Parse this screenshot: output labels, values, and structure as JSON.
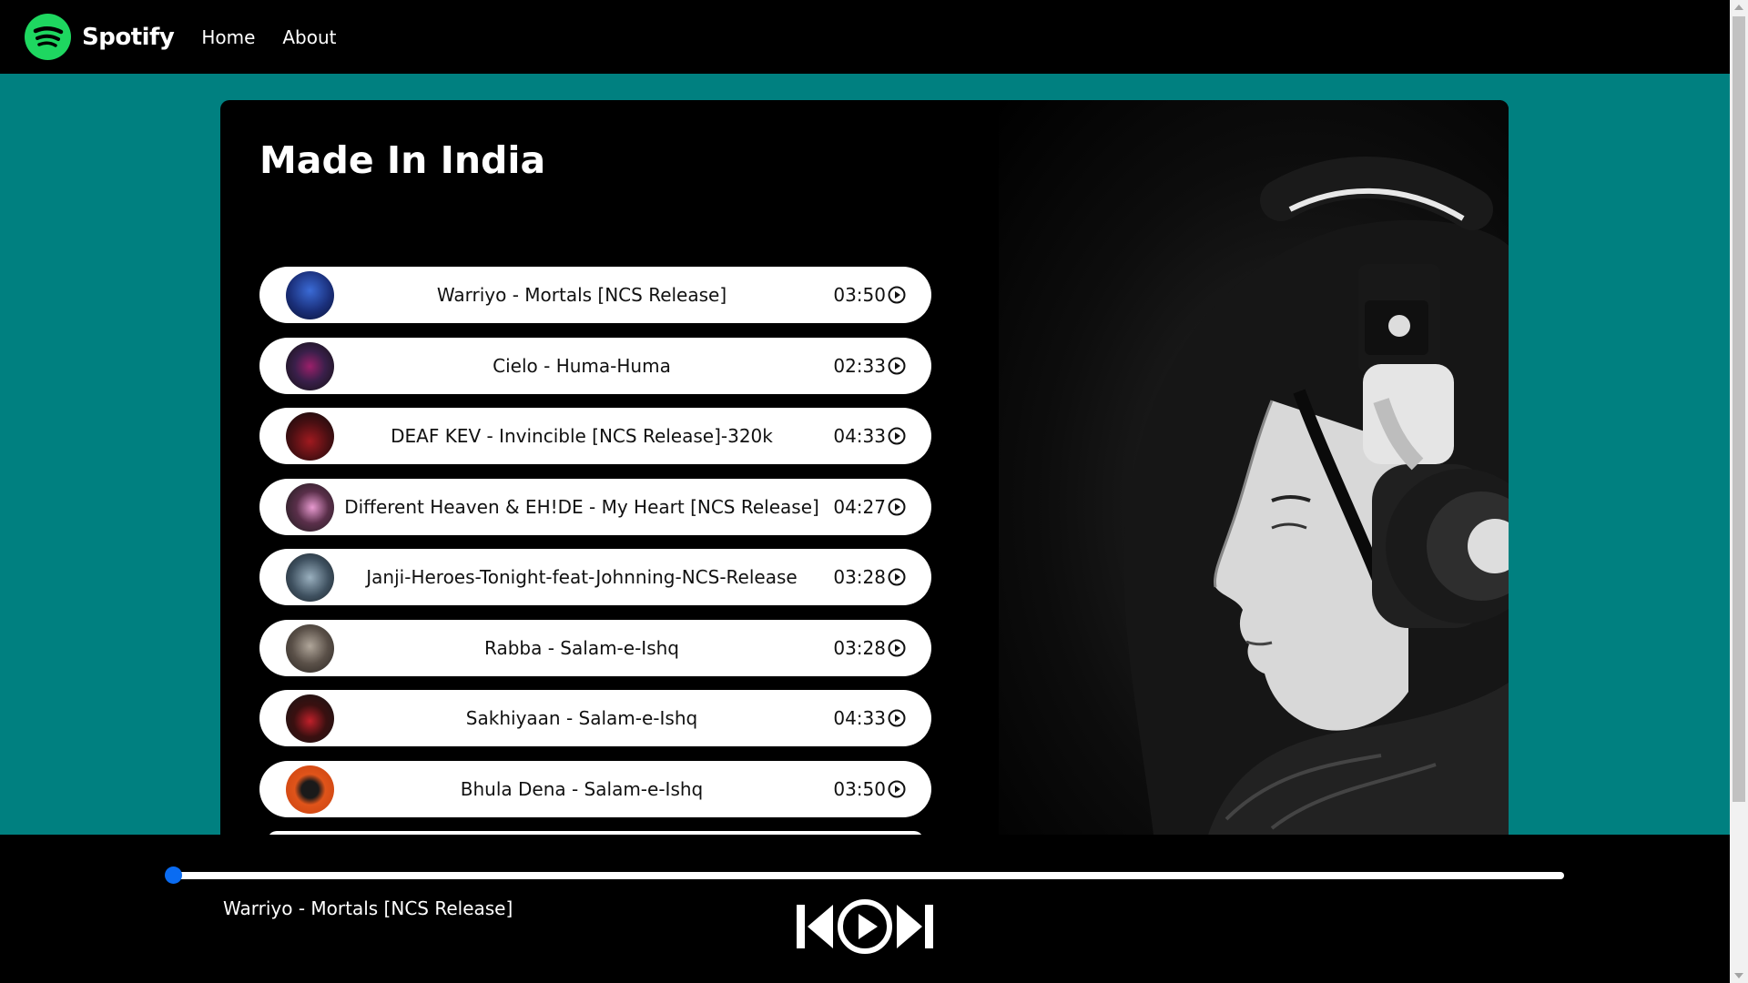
{
  "nav": {
    "brand": "Spotify",
    "links": [
      "Home",
      "About"
    ]
  },
  "playlist": {
    "title": "Made In India",
    "songs": [
      {
        "name": "Warriyo - Mortals [NCS Release]",
        "duration": "03:50",
        "cover_color": "#1a2f7a"
      },
      {
        "name": "Cielo - Huma-Huma",
        "duration": "02:33",
        "cover_color": "#3a1f4a"
      },
      {
        "name": "DEAF KEV - Invincible [NCS Release]-320k",
        "duration": "04:33",
        "cover_color": "#4a0f12"
      },
      {
        "name": "Different Heaven & EH!DE - My Heart [NCS Release]",
        "duration": "04:27",
        "cover_color": "#5a2f4a"
      },
      {
        "name": "Janji-Heroes-Tonight-feat-Johnning-NCS-Release",
        "duration": "03:28",
        "cover_color": "#3f5160"
      },
      {
        "name": "Rabba - Salam-e-Ishq",
        "duration": "03:28",
        "cover_color": "#5a5048"
      },
      {
        "name": "Sakhiyaan - Salam-e-Ishq",
        "duration": "04:33",
        "cover_color": "#3a1010"
      },
      {
        "name": "Bhula Dena - Salam-e-Ishq",
        "duration": "03:50",
        "cover_color": "#e0541a"
      }
    ]
  },
  "player": {
    "current_song": "Warriyo - Mortals [NCS Release]",
    "progress": 0
  },
  "colors": {
    "background": "#008080",
    "brand_green": "#1ed760",
    "progress_thumb": "#0a6cf2"
  }
}
